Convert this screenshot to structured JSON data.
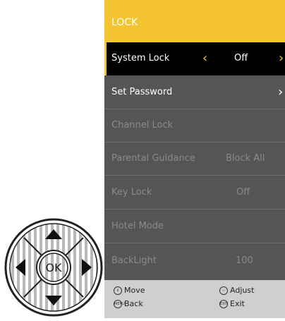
{
  "header": {
    "title": "LOCK"
  },
  "menu": {
    "items": [
      {
        "label": "System Lock",
        "value": "Off"
      },
      {
        "label": "Set Password",
        "value": ""
      },
      {
        "label": "Channel Lock",
        "value": ""
      },
      {
        "label": "Parental Guidance",
        "value": "Block All"
      },
      {
        "label": "Key Lock",
        "value": "Off"
      },
      {
        "label": "Hotel Mode",
        "value": ""
      },
      {
        "label": "BackLight",
        "value": "100"
      }
    ]
  },
  "footer": {
    "move_label": "Move",
    "adjust_label": "Adjust",
    "back_label": "Back",
    "exit_label": "Exit",
    "menu_icon_text": "MENU",
    "exit_icon_text": "EXIT"
  },
  "remote": {
    "ok_label": "OK"
  },
  "colors": {
    "accent": "#f5c531",
    "panel": "#555555",
    "selected_row": "#000000",
    "footer": "#cfcfcf"
  }
}
